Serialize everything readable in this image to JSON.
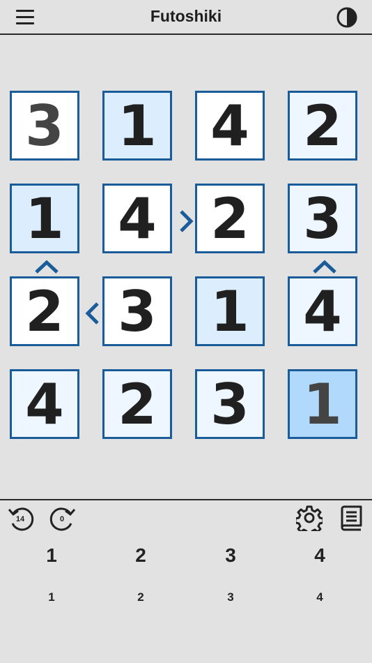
{
  "header": {
    "title": "Futoshiki",
    "menu_icon": "hamburger-menu-icon",
    "theme_icon": "contrast-toggle-icon"
  },
  "board": {
    "size": 4,
    "rows": [
      [
        "3",
        "1",
        "4",
        "2"
      ],
      [
        "1",
        "4",
        "2",
        "3"
      ],
      [
        "2",
        "3",
        "1",
        "4"
      ],
      [
        "4",
        "2",
        "3",
        "1"
      ]
    ],
    "inequalities": [
      {
        "between": "r2c2-r2c3",
        "symbol": ">"
      },
      {
        "between": "r2c1-r3c1",
        "symbol": "^"
      },
      {
        "between": "r2c4-r3c4",
        "symbol": "^"
      },
      {
        "between": "r3c1-r3c2",
        "symbol": "<"
      }
    ],
    "colors": {
      "border": "#1a5c9a",
      "white": "#ffffff",
      "light": "#eef7ff",
      "medium": "#dcedfd",
      "selected": "#b1d9fb"
    }
  },
  "toolbar": {
    "undo_count": "14",
    "redo_count": "0",
    "undo_icon": "undo-icon",
    "redo_icon": "redo-icon",
    "settings_icon": "gear-icon",
    "rules_icon": "book-icon"
  },
  "number_pad": {
    "values": [
      "1",
      "2",
      "3",
      "4"
    ],
    "notes": [
      "1",
      "2",
      "3",
      "4"
    ]
  }
}
